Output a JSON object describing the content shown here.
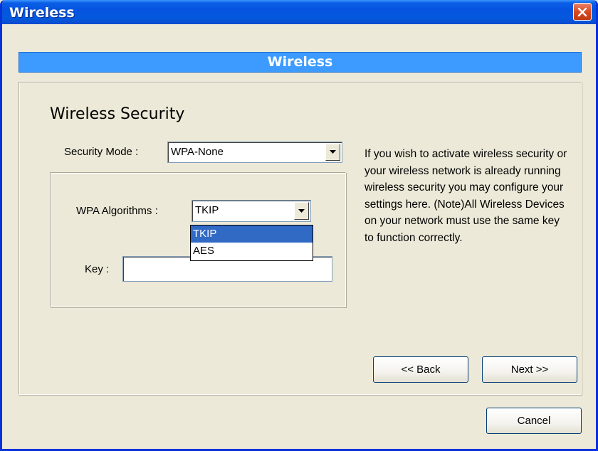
{
  "window": {
    "title": "Wireless"
  },
  "banner": {
    "title": "Wireless"
  },
  "section": {
    "heading": "Wireless Security"
  },
  "security_mode": {
    "label": "Security Mode :",
    "selected": "WPA-None"
  },
  "wpa_algorithms": {
    "label": "WPA Algorithms :",
    "selected": "TKIP",
    "options": [
      "TKIP",
      "AES"
    ],
    "highlighted_index": 0
  },
  "key": {
    "label": "Key :",
    "value": ""
  },
  "help": {
    "text": "If you wish to activate wireless security or your wireless network is already running wireless security you may configure your settings here. (Note)All Wireless Devices on your network must use the same key to function correctly."
  },
  "buttons": {
    "back": "<< Back",
    "next": "Next >>",
    "cancel": "Cancel"
  },
  "colors": {
    "titlebar": "#0553e0",
    "banner": "#3d9bff",
    "selection": "#316ac5",
    "dialog_bg": "#ece9d8"
  }
}
